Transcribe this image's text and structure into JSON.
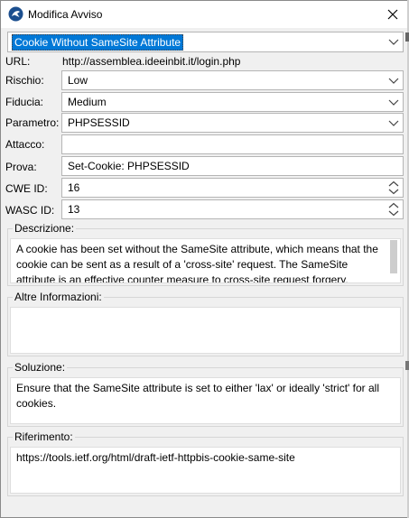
{
  "window": {
    "title": "Modifica Avviso",
    "app_icon": "zap-logo-icon",
    "close_icon": "close-icon"
  },
  "alert": {
    "name": "Cookie Without SameSite Attribute"
  },
  "fields": {
    "url_label": "URL:",
    "url_value": "http://assemblea.ideeinbit.it/login.php",
    "rischio_label": "Rischio:",
    "rischio_value": "Low",
    "fiducia_label": "Fiducia:",
    "fiducia_value": "Medium",
    "parametro_label": "Parametro:",
    "parametro_value": "PHPSESSID",
    "attacco_label": "Attacco:",
    "attacco_value": "",
    "prova_label": "Prova:",
    "prova_value": "Set-Cookie: PHPSESSID",
    "cwe_label": "CWE ID:",
    "cwe_value": "16",
    "wasc_label": "WASC ID:",
    "wasc_value": "13"
  },
  "sections": {
    "descrizione_title": "Descrizione:",
    "descrizione_text": "A cookie has been set without the SameSite attribute, which means that the cookie can be sent as a result of a 'cross-site' request. The SameSite attribute is an effective counter measure to cross-site request forgery,",
    "altre_title": "Altre Informazioni:",
    "altre_text": "",
    "soluzione_title": "Soluzione:",
    "soluzione_text": "Ensure that the SameSite attribute is set to either 'lax' or ideally 'strict' for all cookies.",
    "riferimento_title": "Riferimento:",
    "riferimento_text": "https://tools.ietf.org/html/draft-ietf-httpbis-cookie-same-site"
  },
  "colors": {
    "selection": "#0078d7",
    "background": "#f0f0f0"
  }
}
